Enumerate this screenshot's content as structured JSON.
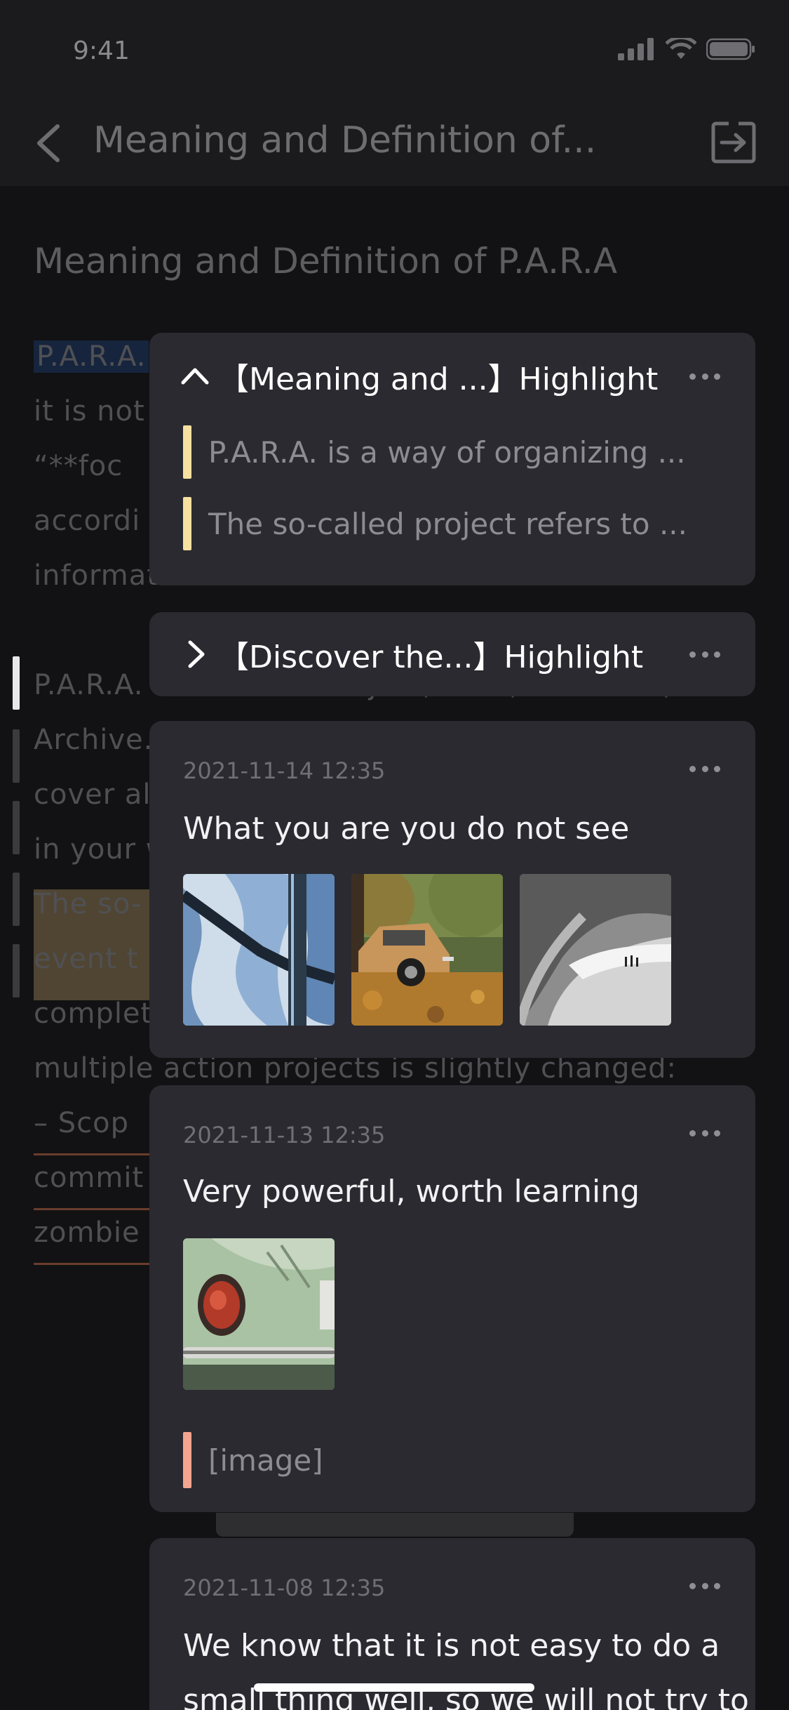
{
  "status_bar": {
    "time": "9:41"
  },
  "nav": {
    "title": "Meaning and Definition of..."
  },
  "article": {
    "title": "Meaning and Definition of P.A.R.A",
    "lines": [
      "P.A.R.A.",
      "it  is  not",
      "“**foc",
      "accordi",
      "information",
      "P.A.R.A. is short for Project, Area, Resource, and",
      "Archive.",
      "cover al",
      "in your w",
      "The  so-",
      "event  t",
      "complet",
      "multiple action projects is slightly changed:",
      "–  Scop",
      "commit",
      "zombie"
    ]
  },
  "groups": [
    {
      "title": "【Meaning and ...】Highlight",
      "expanded": true,
      "items": [
        "P.A.R.A. is a way of organizing ...",
        "The so-called project refers to ..."
      ]
    },
    {
      "title": "【Discover the...】Highlight",
      "expanded": false
    }
  ],
  "notes": [
    {
      "date": "2021-11-14  12:35",
      "text": "What you are you do not see",
      "images": [
        "snowy-tree-photo",
        "vintage-car-autumn-photo",
        "curved-architecture-photo"
      ]
    },
    {
      "date": "2021-11-13  12:35",
      "text": "Very powerful, worth learning",
      "images": [
        "green-beetle-car-photo"
      ],
      "highlight": "[image]"
    },
    {
      "date": "2021-11-08  12:35",
      "text_lines": [
        "We know that it is not easy to do a",
        "small thing well, so we will not try to"
      ]
    }
  ],
  "colors": {
    "card_bg": "#2a2a30",
    "highlight_yellow": "#f7e0a0",
    "highlight_red": "#f3a590",
    "screen_bg": "#121214"
  }
}
